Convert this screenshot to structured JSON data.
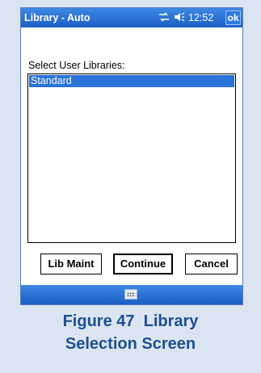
{
  "window": {
    "title": "Library - Auto",
    "time": "12:52",
    "ok_label": "ok",
    "status_icons": [
      "connectivity-icon",
      "speaker-icon"
    ]
  },
  "prompt": "Select User Libraries:",
  "libraries": {
    "items": [
      "Standard"
    ],
    "selected": "Standard"
  },
  "buttons": {
    "lib_maint": "Lib Maint",
    "continue": "Continue",
    "cancel": "Cancel"
  },
  "taskbar": {
    "input_icon": "keyboard-icon"
  },
  "caption": {
    "line1": "Figure 47  Library",
    "line2": "Selection Screen"
  },
  "colors": {
    "titlebar": "#1a5fc6",
    "selection": "#2a73d8",
    "caption_text": "#1f4f8e",
    "page_background": "#dbe5f1"
  }
}
